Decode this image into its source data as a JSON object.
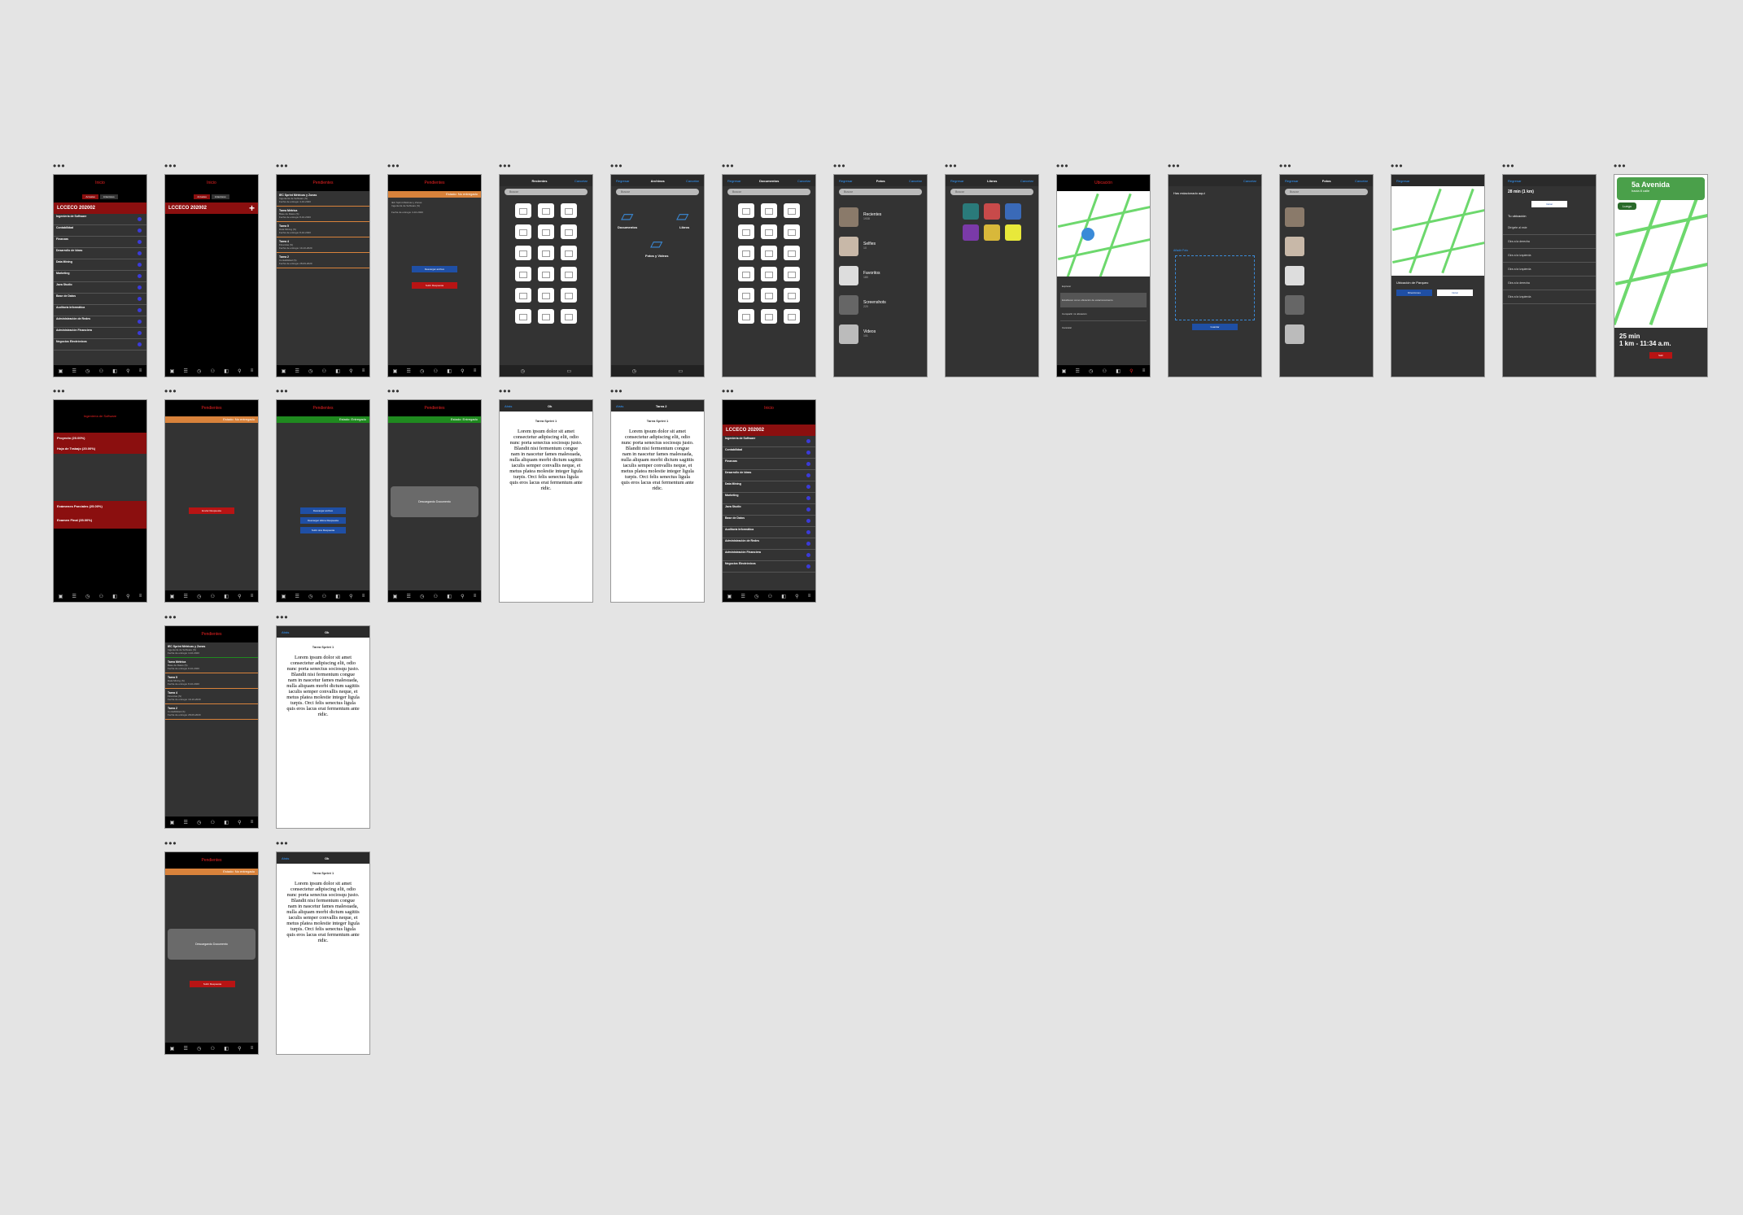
{
  "row1": {
    "p1": {
      "title": "Inicio",
      "tabs": [
        "Actuales",
        "Anteriores"
      ],
      "course": "LCCECO 202002",
      "items": [
        "Ingeniería de Software",
        "Contabilidad",
        "Finanzas",
        "Desarrollo de Ideas",
        "Data Mining",
        "Marketing",
        "Java Studio",
        "Base de Datos",
        "Auditoría Informática",
        "Administración de Redes",
        "Administración Financiera",
        "Negocios Electrónicos"
      ]
    },
    "p2": {
      "title": "Inicio",
      "tabs": [
        "Actuales",
        "Anteriores"
      ],
      "course": "LCCECO 202002"
    },
    "p3": {
      "title": "Pendientes"
    },
    "p4": {
      "title": "Pendientes",
      "status": "Estado: No entregado",
      "btn1": "Descargar archivo",
      "btn2": "Subir Respuesta"
    },
    "p5": {
      "back": "Regresar",
      "title": "Recientes",
      "action": "Cancelar",
      "search": "Buscar"
    },
    "p6": {
      "back": "Regresar",
      "title": "Archivos",
      "action": "Cancelar",
      "search": "Buscar",
      "folders": [
        "Documentos",
        "Libros",
        "Fotos y Vídeos"
      ]
    },
    "p7": {
      "back": "Regresar",
      "title": "Documentos",
      "action": "Cancelar",
      "search": "Buscar"
    },
    "p8": {
      "back": "Regresar",
      "title": "Fotos",
      "action": "Cancelar",
      "search": "Buscar",
      "albums": [
        {
          "name": "Recientes",
          "count": "1938"
        },
        {
          "name": "Selfies",
          "count": "10"
        },
        {
          "name": "Favoritos",
          "count": "180"
        },
        {
          "name": "Screenshots",
          "count": "220"
        },
        {
          "name": "Videos",
          "count": "101"
        }
      ]
    },
    "p9": {
      "back": "Regresar",
      "title": "Libros",
      "action": "Cancelar",
      "search": "Buscar"
    },
    "p10": {
      "title": "Ubicación",
      "menu": [
        "Explorar",
        "Establecer como ubicación de estacionamiento",
        "Compartir mi ubicación",
        "Cancelar"
      ]
    },
    "p11": {
      "action": "Cancelar",
      "loc1": "Has estacionado aquí",
      "loc2": "Añadir Foto",
      "save": "Guardar"
    },
    "p12": {
      "back": "Regresar",
      "title": "Fotos",
      "action": "Cancelar",
      "search": "Buscar"
    },
    "p13": {
      "back": "Regresar",
      "place": "Ubicación de Parqueo",
      "btn1": "Direcciones",
      "btn2": "Iniciar"
    },
    "p14": {
      "back": "Regresar",
      "eta": "28 min (1 km)",
      "start": "Iniciar",
      "loc": "Tu ubicación",
      "steps": [
        "Dirígete al este",
        "Gira a la derecha",
        "Gira a la izquierda",
        "Gira a la izquierda",
        "Gira a la derecha",
        "Gira a la izquierda"
      ]
    },
    "p15": {
      "street": "5a Avenida",
      "sub": "hacia 8 calle",
      "then": "Luego",
      "time": "25 min",
      "dist": "1 km - 11:34 a.m.",
      "exit": "Salir"
    }
  },
  "row2": {
    "p1": {
      "title": "Ingeniería de Software",
      "rows": [
        "Proyecto (20.00%)",
        "Hoja de Trabajo (20.00%)",
        "Exámenes Parciales (25.00%)",
        "Examen Final (35.00%)"
      ]
    },
    "p2": {
      "title": "Pendientes",
      "status": "Estado: No entregado",
      "btn": "Enviar Respuesta"
    },
    "p3": {
      "title": "Pendientes",
      "status": "Estado: Entregado",
      "btns": [
        "Descargar archivo",
        "Descargar última Respuesta",
        "Subir otra Respuesta"
      ]
    },
    "p4": {
      "title": "Pendientes",
      "status": "Estado: Entregado",
      "loading": "Descargando Documento"
    },
    "p5": {
      "back": "Atrás",
      "title": "Ok",
      "heading": "Tarea Sprint 1"
    },
    "p6": {
      "back": "Atrás",
      "title": "Tarea 2",
      "heading": "Tarea Sprint 1"
    },
    "p7": {
      "title": "Inicio",
      "course": "LCCECO 202002"
    }
  },
  "row3": {
    "p1": {
      "title": "Pendientes"
    },
    "p2": {
      "back": "Atrás",
      "title": "Ok",
      "heading": "Tarea Sprint 1"
    }
  },
  "row4": {
    "p1": {
      "title": "Pendientes",
      "status": "Estado: No entregado",
      "loading": "Descargando Documento",
      "btn": "Subir Respuesta"
    },
    "p2": {
      "back": "Atrás",
      "title": "Ok",
      "heading": "Tarea Sprint 1"
    }
  },
  "lorem": "Lorem ipsum dolor sit amet consectetur adipiscing elit, odio nunc porta senectus sociosqu justo. Blandit nisi fermentum congue nam in nascetur fames malesuada, nulla aliquam morbi dictum sagittis iaculis semper convallis neque, et metus platea molestie integer ligula turpis. Orci felis senectus ligula quis eros lacus erat fermentum ante ridic."
}
